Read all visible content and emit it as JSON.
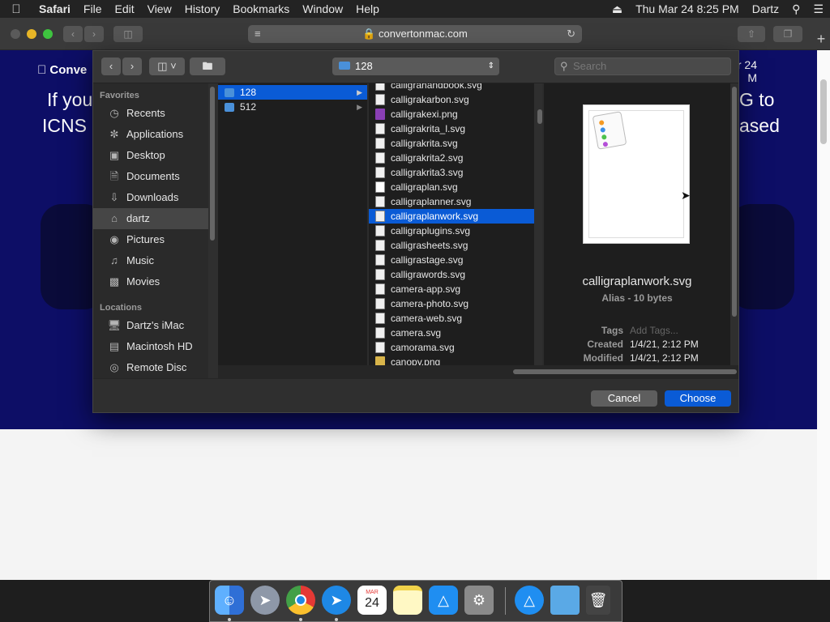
{
  "menubar": {
    "app": "Safari",
    "items": [
      "File",
      "Edit",
      "View",
      "History",
      "Bookmarks",
      "Window",
      "Help"
    ],
    "clock": "Thu Mar 24  8:25 PM",
    "user": "Dartz"
  },
  "safari": {
    "url": "convertonmac.com"
  },
  "webpage": {
    "logo": "Conve",
    "line1_left": "If you",
    "line1_right": "G to",
    "line2_left": "ICNS (",
    "line2_right": "ased",
    "date_line1": "r 24",
    "date_line2": "M"
  },
  "dialog": {
    "path": "128",
    "search_placeholder": "Search",
    "sidebar": {
      "favorites_header": "Favorites",
      "favorites": [
        {
          "label": "Recents",
          "icon": "clock-icon"
        },
        {
          "label": "Applications",
          "icon": "applications-icon"
        },
        {
          "label": "Desktop",
          "icon": "desktop-icon"
        },
        {
          "label": "Documents",
          "icon": "documents-icon"
        },
        {
          "label": "Downloads",
          "icon": "downloads-icon"
        },
        {
          "label": "dartz",
          "icon": "home-icon"
        },
        {
          "label": "Pictures",
          "icon": "camera-icon"
        },
        {
          "label": "Music",
          "icon": "music-icon"
        },
        {
          "label": "Movies",
          "icon": "film-icon"
        }
      ],
      "locations_header": "Locations",
      "locations": [
        {
          "label": "Dartz's iMac",
          "icon": "imac-icon"
        },
        {
          "label": "Macintosh HD",
          "icon": "disk-icon"
        },
        {
          "label": "Remote Disc",
          "icon": "disc-icon"
        }
      ]
    },
    "column1": [
      "128",
      "512"
    ],
    "column2": [
      "calligrahandbook.svg",
      "calligrakarbon.svg",
      "calligrakexi.png",
      "calligrakrita_l.svg",
      "calligrakrita.svg",
      "calligrakrita2.svg",
      "calligrakrita3.svg",
      "calligraplan.svg",
      "calligraplanner.svg",
      "calligraplanwork.svg",
      "calligraplugins.svg",
      "calligrasheets.svg",
      "calligrastage.svg",
      "calligrawords.svg",
      "camera-app.svg",
      "camera-photo.svg",
      "camera-web.svg",
      "camera.svg",
      "camorama.svg",
      "canopy.png"
    ],
    "preview": {
      "name": "calligraplanwork.svg",
      "kind": "Alias - 10 bytes",
      "tags_label": "Tags",
      "tags_placeholder": "Add Tags...",
      "created_label": "Created",
      "created_value": "1/4/21, 2:12 PM",
      "modified_label": "Modified",
      "modified_value": "1/4/21, 2:12 PM"
    },
    "cancel_label": "Cancel",
    "choose_label": "Choose"
  },
  "dock": {
    "apps": [
      "Finder",
      "Launchpad",
      "Chrome",
      "Safari",
      "Calendar",
      "Notes",
      "App Store",
      "System Preferences",
      "App Store",
      "Folder",
      "Trash"
    ],
    "calendar_month": "MAR",
    "calendar_day": "24"
  },
  "colors": {
    "accent": "#0a5bd6",
    "webpage_bg": "#0d0e66"
  }
}
